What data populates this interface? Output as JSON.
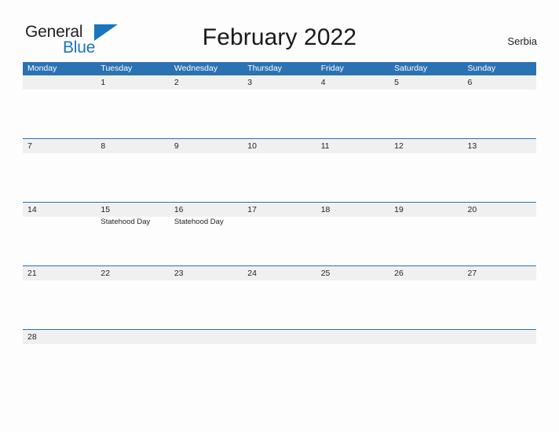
{
  "brand": {
    "name_part1": "General",
    "name_part2": "Blue",
    "flag_icon": "triangle-flag-icon"
  },
  "header": {
    "title": "February 2022",
    "country": "Serbia"
  },
  "colors": {
    "header_blue": "#2b72b2",
    "row_line_blue": "#2b72b2",
    "date_band_gray": "#f0f0f0",
    "logo_blue": "#1b75bc",
    "text_dark": "#231f20",
    "page_bg": "#fdfdfd"
  },
  "calendar": {
    "month": "February",
    "year": "2022",
    "weekdays": [
      "Monday",
      "Tuesday",
      "Wednesday",
      "Thursday",
      "Friday",
      "Saturday",
      "Sunday"
    ],
    "weeks": [
      [
        {
          "date": "",
          "events": []
        },
        {
          "date": "1",
          "events": []
        },
        {
          "date": "2",
          "events": []
        },
        {
          "date": "3",
          "events": []
        },
        {
          "date": "4",
          "events": []
        },
        {
          "date": "5",
          "events": []
        },
        {
          "date": "6",
          "events": []
        }
      ],
      [
        {
          "date": "7",
          "events": []
        },
        {
          "date": "8",
          "events": []
        },
        {
          "date": "9",
          "events": []
        },
        {
          "date": "10",
          "events": []
        },
        {
          "date": "11",
          "events": []
        },
        {
          "date": "12",
          "events": []
        },
        {
          "date": "13",
          "events": []
        }
      ],
      [
        {
          "date": "14",
          "events": []
        },
        {
          "date": "15",
          "events": [
            "Statehood Day"
          ]
        },
        {
          "date": "16",
          "events": [
            "Statehood Day"
          ]
        },
        {
          "date": "17",
          "events": []
        },
        {
          "date": "18",
          "events": []
        },
        {
          "date": "19",
          "events": []
        },
        {
          "date": "20",
          "events": []
        }
      ],
      [
        {
          "date": "21",
          "events": []
        },
        {
          "date": "22",
          "events": []
        },
        {
          "date": "23",
          "events": []
        },
        {
          "date": "24",
          "events": []
        },
        {
          "date": "25",
          "events": []
        },
        {
          "date": "26",
          "events": []
        },
        {
          "date": "27",
          "events": []
        }
      ],
      [
        {
          "date": "28",
          "events": []
        },
        {
          "date": "",
          "events": []
        },
        {
          "date": "",
          "events": []
        },
        {
          "date": "",
          "events": []
        },
        {
          "date": "",
          "events": []
        },
        {
          "date": "",
          "events": []
        },
        {
          "date": "",
          "events": []
        }
      ]
    ]
  }
}
